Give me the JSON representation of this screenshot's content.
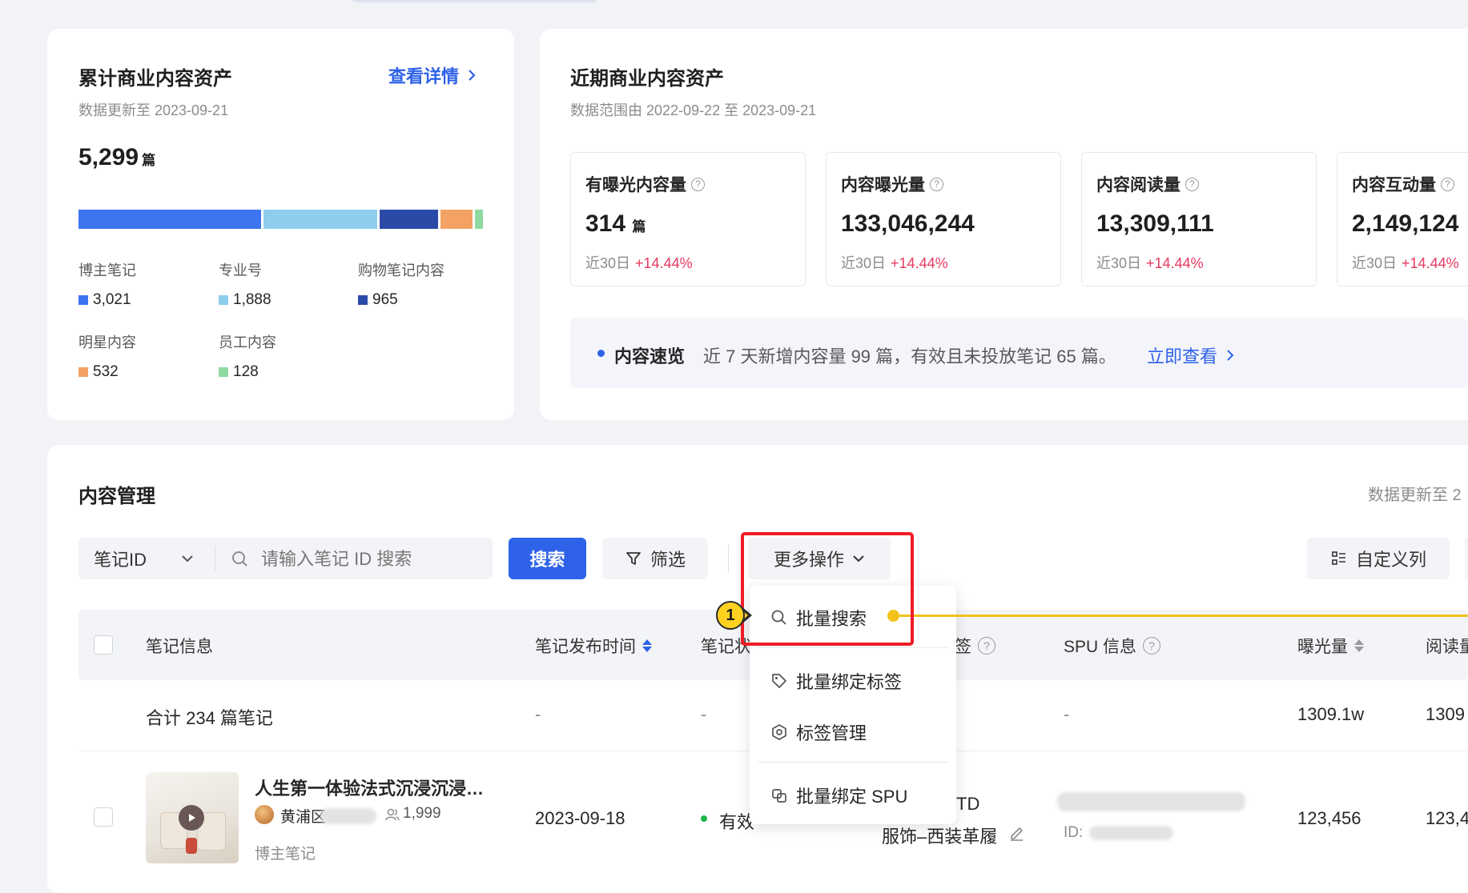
{
  "accumulated": {
    "title": "累计商业内容资产",
    "detail_link": "查看详情",
    "updated": "数据更新至 2023-09-21",
    "total_value": "5,299",
    "total_unit": "篇",
    "composition": [
      {
        "label": "博主笔记",
        "value": "3,021",
        "color": "#3d74f0",
        "share": 0.57
      },
      {
        "label": "专业号",
        "value": "1,888",
        "color": "#8fcdec",
        "share": 0.356
      },
      {
        "label": "购物笔记内容",
        "value": "965",
        "color": "#2b4aa8",
        "share": 0.182
      },
      {
        "label": "明星内容",
        "value": "532",
        "color": "#f4a263",
        "share": 0.1
      },
      {
        "label": "员工内容",
        "value": "128",
        "color": "#8fd9a3",
        "share": 0.024
      }
    ]
  },
  "recent": {
    "title": "近期商业内容资产",
    "range": "数据范围由 2022-09-22 至 2023-09-21",
    "metrics": [
      {
        "title": "有曝光内容量",
        "value": "314",
        "unit": "篇",
        "foot_label": "近30日",
        "foot_change": "+14.44%"
      },
      {
        "title": "内容曝光量",
        "value": "133,046,244",
        "unit": "",
        "foot_label": "近30日",
        "foot_change": "+14.44%"
      },
      {
        "title": "内容阅读量",
        "value": "13,309,111",
        "unit": "",
        "foot_label": "近30日",
        "foot_change": "+14.44%"
      },
      {
        "title": "内容互动量",
        "value": "2,149,124",
        "unit": "",
        "foot_label": "近30日",
        "foot_change": "+14.44%"
      }
    ],
    "overview_label": "内容速览",
    "overview_text": "近 7 天新增内容量 99 篇，有效且未投放笔记 65 篇。",
    "overview_link": "立即查看"
  },
  "content_mgmt": {
    "title": "内容管理",
    "updated": "数据更新至 2",
    "select_value": "笔记ID",
    "search_placeholder": "请输入笔记 ID 搜索",
    "search_btn": "搜索",
    "filter_btn": "筛选",
    "more_btn": "更多操作",
    "custom_cols_btn": "自定义列",
    "columns": [
      "笔记信息",
      "笔记发布时间",
      "笔记状",
      "签",
      "SPU 信息",
      "曝光量",
      "阅读量"
    ],
    "summary": {
      "label": "合计 234 篇笔记",
      "publish": "-",
      "status": "-",
      "spu": "-",
      "exposure": "1309.1w",
      "read": "1309"
    },
    "row": {
      "title": "人生第一体验法式沉浸沉浸…",
      "author": "黄浦区",
      "followers": "1,999",
      "type": "博主笔记",
      "publish": "2023-09-18",
      "status": "有效",
      "tag_line1": "TD",
      "tag_line2": "服饰–西装革履",
      "spu_id_label": "ID:",
      "exposure": "123,456",
      "read": "123,4"
    }
  },
  "dropdown": {
    "items": [
      "批量搜索",
      "批量绑定标签",
      "标签管理",
      "批量绑定 SPU"
    ]
  },
  "annotation": {
    "marker": "1",
    "color": "#f2c21b",
    "highlight": "#ee1c25"
  }
}
